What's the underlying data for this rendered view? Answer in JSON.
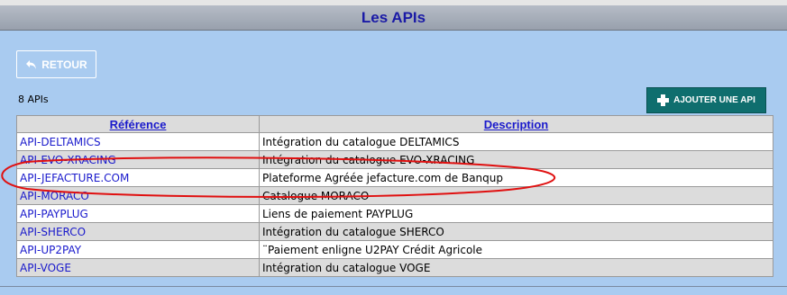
{
  "header": {
    "title": "Les APIs"
  },
  "toolbar": {
    "back_label": "RETOUR",
    "add_label": "AJOUTER UNE API"
  },
  "summary": {
    "count_text": "8 APIs"
  },
  "table": {
    "headers": {
      "reference": "Référence",
      "description": "Description"
    },
    "rows": [
      {
        "reference": "API-DELTAMICS",
        "description": "Intégration du catalogue DELTAMICS"
      },
      {
        "reference": "API-EVO-XRACING",
        "description": "Intégration du catalogue EVO-XRACING"
      },
      {
        "reference": "API-JEFACTURE.COM",
        "description": "Plateforme Agréée jefacture.com de Banqup"
      },
      {
        "reference": "API-MORACO",
        "description": "Catalogue MORACO"
      },
      {
        "reference": "API-PAYPLUG",
        "description": "Liens de paiement PAYPLUG"
      },
      {
        "reference": "API-SHERCO",
        "description": "Intégration du catalogue SHERCO"
      },
      {
        "reference": "API-UP2PAY",
        "description": "¨Paiement enligne U2PAY Crédit Agricole"
      },
      {
        "reference": "API-VOGE",
        "description": "Intégration du catalogue VOGE"
      }
    ]
  },
  "icons": {
    "back": "undo-arrow-icon",
    "add": "plus-icon"
  },
  "colors": {
    "background": "#a9cbf0",
    "title_text": "#1a1aa6",
    "link": "#1a1acc",
    "add_button": "#0f6e6e",
    "annotation": "#e01010"
  }
}
